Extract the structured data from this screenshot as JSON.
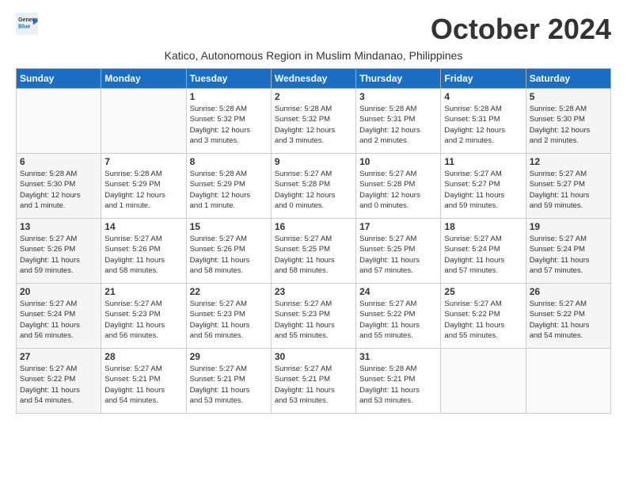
{
  "logo": {
    "line1": "General",
    "line2": "Blue"
  },
  "title": "October 2024",
  "subtitle": "Katico, Autonomous Region in Muslim Mindanao, Philippines",
  "weekdays": [
    "Sunday",
    "Monday",
    "Tuesday",
    "Wednesday",
    "Thursday",
    "Friday",
    "Saturday"
  ],
  "weeks": [
    [
      null,
      null,
      {
        "day": "1",
        "info": "Sunrise: 5:28 AM\nSunset: 5:32 PM\nDaylight: 12 hours\nand 3 minutes."
      },
      {
        "day": "2",
        "info": "Sunrise: 5:28 AM\nSunset: 5:32 PM\nDaylight: 12 hours\nand 3 minutes."
      },
      {
        "day": "3",
        "info": "Sunrise: 5:28 AM\nSunset: 5:31 PM\nDaylight: 12 hours\nand 2 minutes."
      },
      {
        "day": "4",
        "info": "Sunrise: 5:28 AM\nSunset: 5:31 PM\nDaylight: 12 hours\nand 2 minutes."
      },
      {
        "day": "5",
        "info": "Sunrise: 5:28 AM\nSunset: 5:30 PM\nDaylight: 12 hours\nand 2 minutes."
      }
    ],
    [
      {
        "day": "6",
        "info": "Sunrise: 5:28 AM\nSunset: 5:30 PM\nDaylight: 12 hours\nand 1 minute."
      },
      {
        "day": "7",
        "info": "Sunrise: 5:28 AM\nSunset: 5:29 PM\nDaylight: 12 hours\nand 1 minute."
      },
      {
        "day": "8",
        "info": "Sunrise: 5:28 AM\nSunset: 5:29 PM\nDaylight: 12 hours\nand 1 minute."
      },
      {
        "day": "9",
        "info": "Sunrise: 5:27 AM\nSunset: 5:28 PM\nDaylight: 12 hours\nand 0 minutes."
      },
      {
        "day": "10",
        "info": "Sunrise: 5:27 AM\nSunset: 5:28 PM\nDaylight: 12 hours\nand 0 minutes."
      },
      {
        "day": "11",
        "info": "Sunrise: 5:27 AM\nSunset: 5:27 PM\nDaylight: 11 hours\nand 59 minutes."
      },
      {
        "day": "12",
        "info": "Sunrise: 5:27 AM\nSunset: 5:27 PM\nDaylight: 11 hours\nand 59 minutes."
      }
    ],
    [
      {
        "day": "13",
        "info": "Sunrise: 5:27 AM\nSunset: 5:26 PM\nDaylight: 11 hours\nand 59 minutes."
      },
      {
        "day": "14",
        "info": "Sunrise: 5:27 AM\nSunset: 5:26 PM\nDaylight: 11 hours\nand 58 minutes."
      },
      {
        "day": "15",
        "info": "Sunrise: 5:27 AM\nSunset: 5:26 PM\nDaylight: 11 hours\nand 58 minutes."
      },
      {
        "day": "16",
        "info": "Sunrise: 5:27 AM\nSunset: 5:25 PM\nDaylight: 11 hours\nand 58 minutes."
      },
      {
        "day": "17",
        "info": "Sunrise: 5:27 AM\nSunset: 5:25 PM\nDaylight: 11 hours\nand 57 minutes."
      },
      {
        "day": "18",
        "info": "Sunrise: 5:27 AM\nSunset: 5:24 PM\nDaylight: 11 hours\nand 57 minutes."
      },
      {
        "day": "19",
        "info": "Sunrise: 5:27 AM\nSunset: 5:24 PM\nDaylight: 11 hours\nand 57 minutes."
      }
    ],
    [
      {
        "day": "20",
        "info": "Sunrise: 5:27 AM\nSunset: 5:24 PM\nDaylight: 11 hours\nand 56 minutes."
      },
      {
        "day": "21",
        "info": "Sunrise: 5:27 AM\nSunset: 5:23 PM\nDaylight: 11 hours\nand 56 minutes."
      },
      {
        "day": "22",
        "info": "Sunrise: 5:27 AM\nSunset: 5:23 PM\nDaylight: 11 hours\nand 56 minutes."
      },
      {
        "day": "23",
        "info": "Sunrise: 5:27 AM\nSunset: 5:23 PM\nDaylight: 11 hours\nand 55 minutes."
      },
      {
        "day": "24",
        "info": "Sunrise: 5:27 AM\nSunset: 5:22 PM\nDaylight: 11 hours\nand 55 minutes."
      },
      {
        "day": "25",
        "info": "Sunrise: 5:27 AM\nSunset: 5:22 PM\nDaylight: 11 hours\nand 55 minutes."
      },
      {
        "day": "26",
        "info": "Sunrise: 5:27 AM\nSunset: 5:22 PM\nDaylight: 11 hours\nand 54 minutes."
      }
    ],
    [
      {
        "day": "27",
        "info": "Sunrise: 5:27 AM\nSunset: 5:22 PM\nDaylight: 11 hours\nand 54 minutes."
      },
      {
        "day": "28",
        "info": "Sunrise: 5:27 AM\nSunset: 5:21 PM\nDaylight: 11 hours\nand 54 minutes."
      },
      {
        "day": "29",
        "info": "Sunrise: 5:27 AM\nSunset: 5:21 PM\nDaylight: 11 hours\nand 53 minutes."
      },
      {
        "day": "30",
        "info": "Sunrise: 5:27 AM\nSunset: 5:21 PM\nDaylight: 11 hours\nand 53 minutes."
      },
      {
        "day": "31",
        "info": "Sunrise: 5:28 AM\nSunset: 5:21 PM\nDaylight: 11 hours\nand 53 minutes."
      },
      null,
      null
    ]
  ]
}
